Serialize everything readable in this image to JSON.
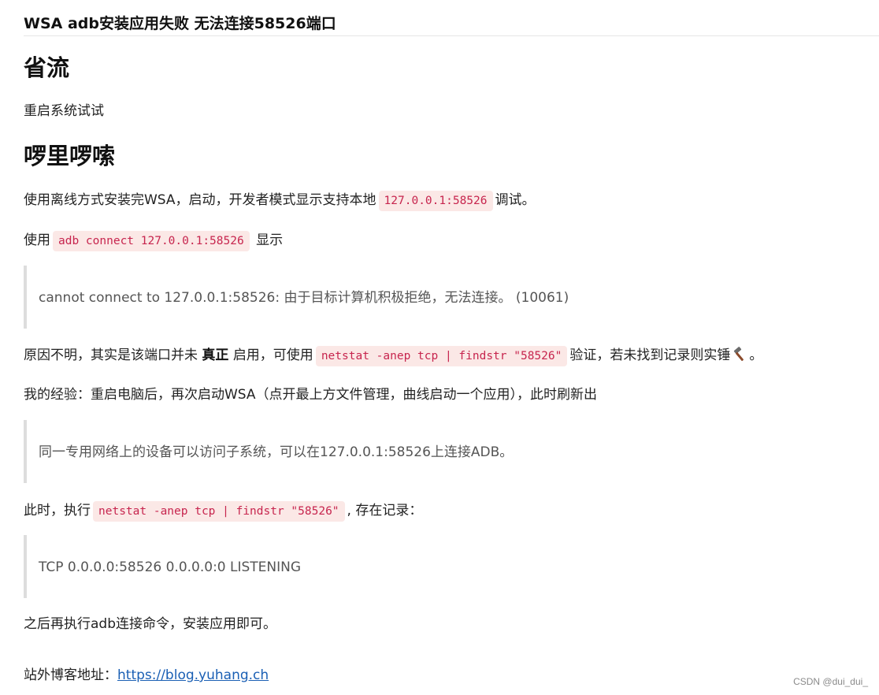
{
  "article": {
    "title": "WSA adb安装应用失败 无法连接58526端口",
    "section1": {
      "heading": "省流",
      "text": "重启系统试试"
    },
    "section2": {
      "heading": "啰里啰嗦",
      "p1_before": "使用离线方式安装完WSA，启动，开发者模式显示支持本地",
      "p1_code": "127.0.0.1:58526",
      "p1_after": "调试。",
      "p2_before": "使用",
      "p2_code": "adb connect 127.0.0.1:58526",
      "p2_after": "显示",
      "quote1": "cannot connect to 127.0.0.1:58526: 由于目标计算机积极拒绝，无法连接。 (10061)",
      "p3_before": "原因不明，其实是该端口并未",
      "p3_bold": "真正",
      "p3_mid": "启用，可使用",
      "p3_code": "netstat -anep tcp | findstr \"58526\"",
      "p3_after": "验证，若未找到记录则实锤",
      "p3_end": "。",
      "p4": "我的经验：重启电脑后，再次启动WSA（点开最上方文件管理，曲线启动一个应用），此时刷新出",
      "quote2": "同一专用网络上的设备可以访问子系统，可以在127.0.0.1:58526上连接ADB。",
      "p5_before": "此时，执行",
      "p5_code": "netstat -anep tcp | findstr \"58526\"",
      "p5_after": ", 存在记录：",
      "quote3": "TCP 0.0.0.0:58526 0.0.0.0:0 LISTENING",
      "p6": "之后再执行adb连接命令，安装应用即可。",
      "p7_label": "站外博客地址：",
      "p7_link": "https://blog.yuhang.ch"
    },
    "watermark": "CSDN @dui_dui_",
    "hammer_icon": "hammer-icon"
  }
}
